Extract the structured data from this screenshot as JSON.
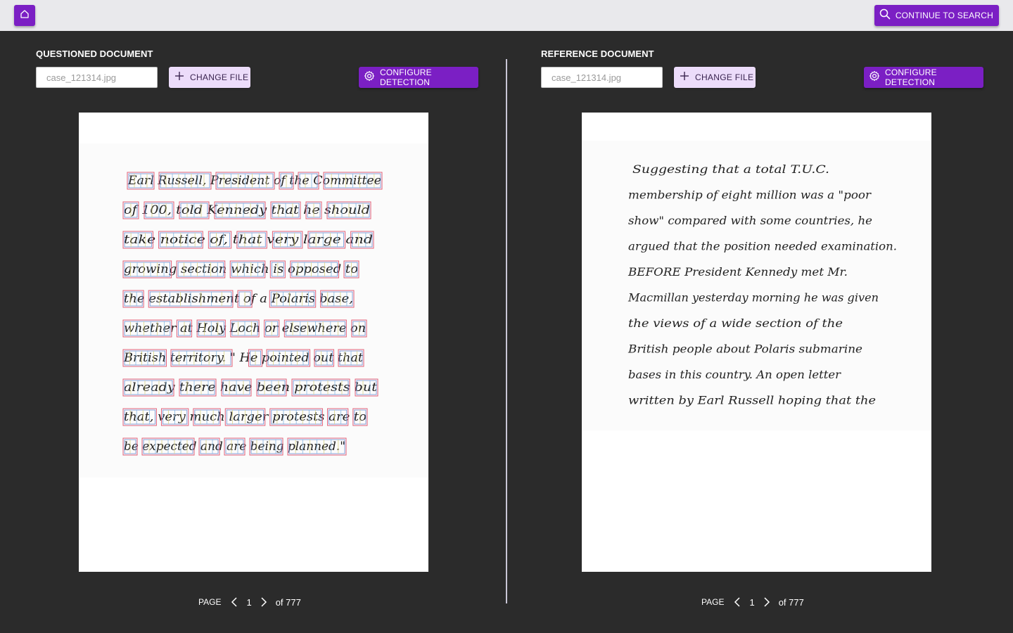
{
  "toolbar": {
    "continue_label": "CONTINUE TO SEARCH",
    "accent_color": "#7b1fc4"
  },
  "questioned": {
    "title": "QUESTIONED DOCUMENT",
    "file_value": "case_121314.jpg",
    "change_label": "CHANGE FILE",
    "config_label": "CONFIGURE DETECTION",
    "pager": {
      "label": "PAGE",
      "page": "1",
      "total": "of 777"
    },
    "lines": [
      "Earl Russell, President of the Committee",
      "of 100, told Kennedy that he should",
      "take notice of, that very large and",
      "growing section which is opposed to",
      "the establishment of a Polaris base,",
      "whether at Holy Loch or elsewhere on",
      "British territory. \" He pointed out that",
      "already there have been protests but",
      "that, very much larger protests are to",
      "be expected and are being planned.\""
    ]
  },
  "reference": {
    "title": "REFERENCE DOCUMENT",
    "file_value": "case_121314.jpg",
    "change_label": "CHANGE FILE",
    "config_label": "CONFIGURE DETECTION",
    "pager": {
      "label": "PAGE",
      "page": "1",
      "total": "of 777"
    },
    "lines": [
      "Suggesting that a total T.U.C.",
      "membership of eight million was a \"poor",
      "show\" compared with some countries, he",
      "argued that the position needed examination.",
      "BEFORE President Kennedy met Mr.",
      "Macmillan yesterday morning he was given",
      "the views of a wide section of the",
      "British people about Polaris submarine",
      "bases in this country. An open letter",
      "written by Earl Russell hoping that the"
    ]
  }
}
